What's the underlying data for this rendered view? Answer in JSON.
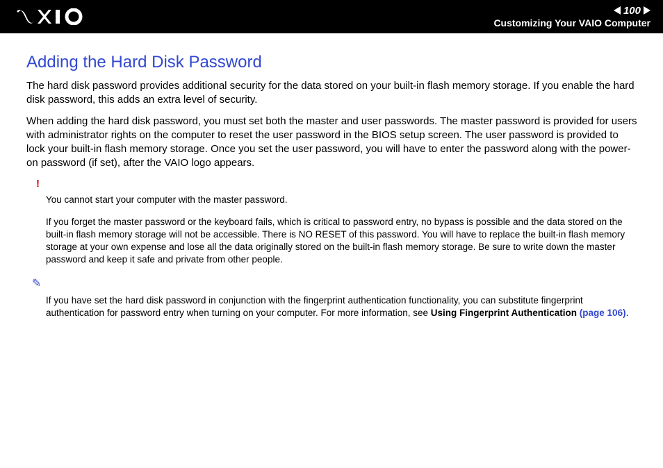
{
  "header": {
    "page_number": "100",
    "section_label": "Customizing Your VAIO Computer"
  },
  "content": {
    "title": "Adding the Hard Disk Password",
    "para1": "The hard disk password provides additional security for the data stored on your built-in flash memory storage. If you enable the hard disk password, this adds an extra level of security.",
    "para2": "When adding the hard disk password, you must set both the master and user passwords. The master password is provided for users with administrator rights on the computer to reset the user password in the BIOS setup screen. The user password is provided to lock your built-in flash memory storage. Once you set the user password, you will have to enter the password along with the power-on password (if set), after the VAIO logo appears.",
    "warn_icon": "!",
    "warn_line1": "You cannot start your computer with the master password.",
    "warn_line2": "If you forget the master password or the keyboard fails, which is critical to password entry, no bypass is possible and the data stored on the built-in flash memory storage will not be accessible. There is NO RESET of this password. You will have to replace the built-in flash memory storage at your own expense and lose all the data originally stored on the built-in flash memory storage. Be sure to write down the master password and keep it safe and private from other people.",
    "tip_icon": "✎",
    "tip_text_prefix": "If you have set the hard disk password in conjunction with the fingerprint authentication functionality, you can substitute fingerprint authentication for password entry when turning on your computer. For more information, see ",
    "tip_bold": "Using Fingerprint Authentication ",
    "tip_link": "(page 106)",
    "tip_suffix": "."
  }
}
